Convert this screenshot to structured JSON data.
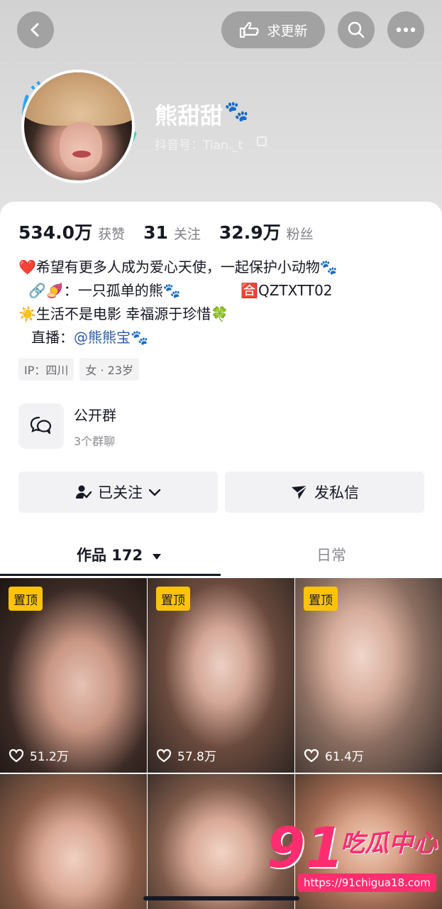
{
  "header": {
    "update_label": "求更新",
    "nickname": "熊甜甜",
    "nickname_emoji": "🐾",
    "douyin_id": "抖音号：Tian._t"
  },
  "stats": [
    {
      "num": "534.0万",
      "label": "获赞"
    },
    {
      "num": "31",
      "label": "关注"
    },
    {
      "num": "32.9万",
      "label": "粉丝"
    }
  ],
  "bio": {
    "line1": "❤️希望有更多人成为爱心天使，一起保护小动物🐾",
    "line2_a": "🔗🍠：一只孤单的熊🐾",
    "line2_b": "🈴QZTXTT02",
    "line3": "☀️生活不是电影 幸福源于珍惜🍀",
    "line4_prefix": "直播：",
    "line4_mention": "@熊熊宝",
    "line4_suffix": "🐾"
  },
  "tags": [
    "IP：四川",
    "女 · 23岁"
  ],
  "group": {
    "title": "公开群",
    "sub": "3个群聊"
  },
  "actions": {
    "follow": "已关注",
    "message": "发私信"
  },
  "tabs": {
    "works": "作品 172",
    "daily": "日常"
  },
  "videos": [
    {
      "pinned": "置顶",
      "likes": "51.2万"
    },
    {
      "pinned": "置顶",
      "likes": "57.8万"
    },
    {
      "pinned": "置顶",
      "likes": "61.4万"
    },
    {
      "pinned": "",
      "likes": ""
    },
    {
      "pinned": "",
      "likes": ""
    },
    {
      "pinned": "",
      "likes": ""
    }
  ],
  "watermark": {
    "num": "91",
    "text": "吃瓜中心",
    "url": "https://91chigua18.com"
  }
}
